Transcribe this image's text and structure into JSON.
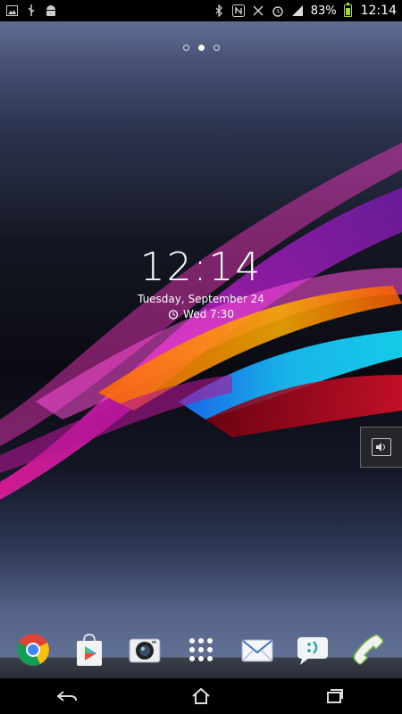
{
  "status_bar": {
    "left_icons": [
      "gallery-icon",
      "usb-icon",
      "android-debug-icon"
    ],
    "right_icons": [
      "bluetooth-icon",
      "nfc-icon",
      "vibrate-icon",
      "alarm-icon",
      "signal-icon",
      "battery-charging-icon"
    ],
    "battery_percent": "83%",
    "battery_level": 0.83,
    "time": "12:14",
    "colors": {
      "battery": "#9be21f"
    }
  },
  "home_pages": {
    "count": 3,
    "active_index": 1
  },
  "clock_widget": {
    "time": "12:14",
    "date": "Tuesday, September 24",
    "alarm": "Wed 7:30"
  },
  "volume_button": {
    "icon": "speaker-icon"
  },
  "dock": {
    "apps": [
      {
        "id": "chrome",
        "icon": "chrome-icon"
      },
      {
        "id": "play-store",
        "icon": "play-store-icon"
      },
      {
        "id": "camera",
        "icon": "camera-icon"
      },
      {
        "id": "app-drawer",
        "icon": "app-drawer-icon"
      },
      {
        "id": "email",
        "icon": "email-icon"
      },
      {
        "id": "messaging",
        "icon": "messaging-icon"
      },
      {
        "id": "phone",
        "icon": "phone-icon"
      }
    ]
  },
  "nav_bar": {
    "buttons": [
      "back-icon",
      "home-icon",
      "recents-icon"
    ]
  }
}
